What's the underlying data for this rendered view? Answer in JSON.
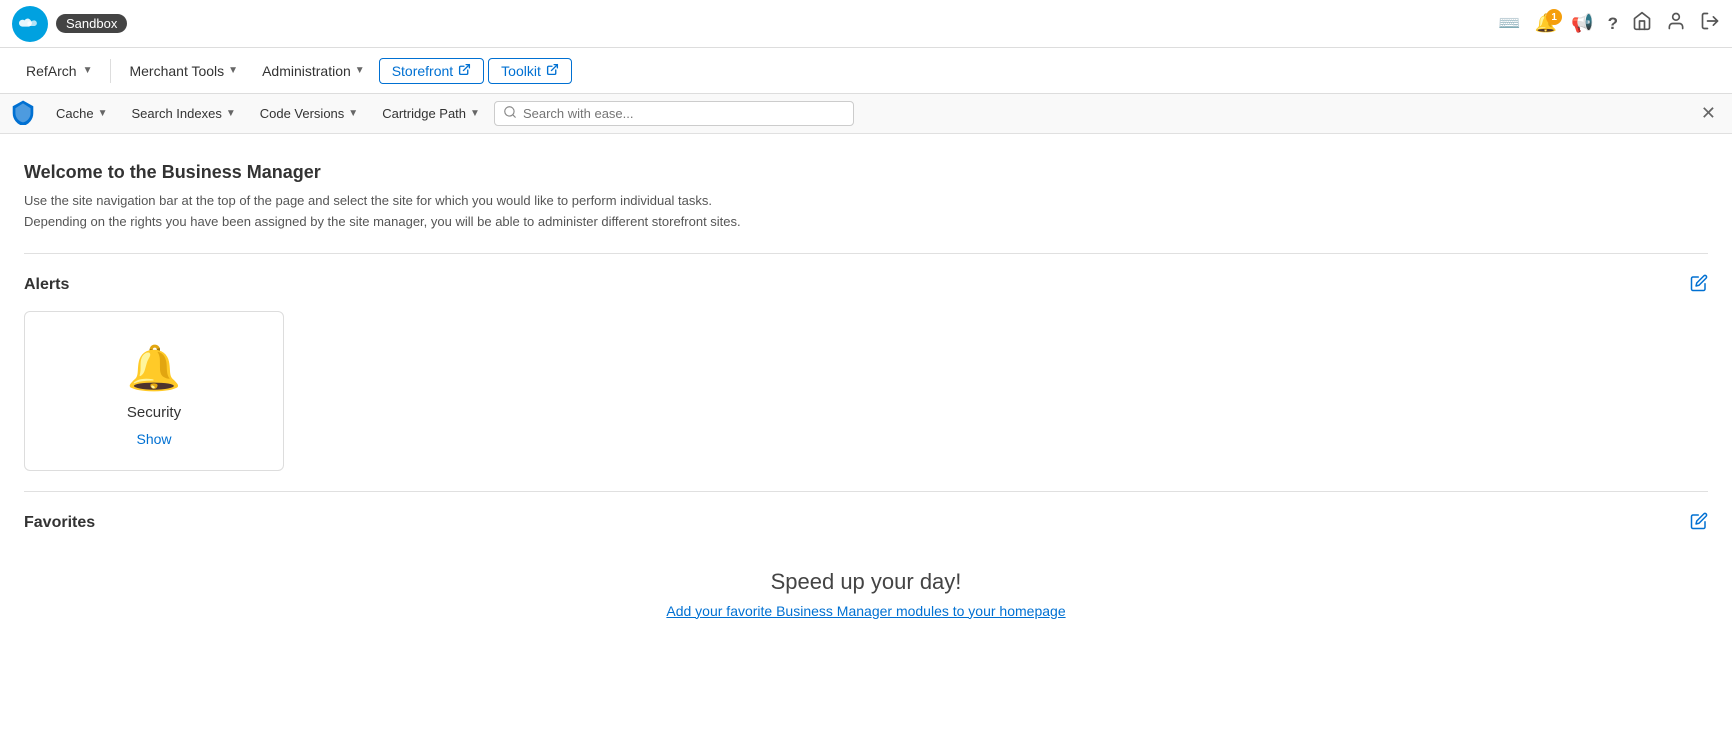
{
  "topBar": {
    "logoAlt": "Salesforce",
    "sandboxLabel": "Sandbox",
    "notificationCount": "1",
    "icons": {
      "keyboard": "⌨",
      "bell": "🔔",
      "megaphone": "📢",
      "help": "?",
      "home": "⌂",
      "user": "👤",
      "signout": "⏻"
    }
  },
  "navBar": {
    "siteSelector": {
      "label": "RefArch",
      "chevron": "▼"
    },
    "items": [
      {
        "label": "Merchant Tools",
        "hasChevron": true
      },
      {
        "label": "Administration",
        "hasChevron": true
      },
      {
        "label": "Storefront",
        "isLink": true,
        "extIcon": "↗"
      },
      {
        "label": "Toolkit",
        "isLink": true,
        "extIcon": "↗"
      }
    ]
  },
  "subNavBar": {
    "items": [
      {
        "label": "Cache",
        "hasChevron": true
      },
      {
        "label": "Search Indexes",
        "hasChevron": true
      },
      {
        "label": "Code Versions",
        "hasChevron": true
      },
      {
        "label": "Cartridge Path",
        "hasChevron": true
      }
    ],
    "searchPlaceholder": "Search with ease..."
  },
  "welcomeSection": {
    "title": "Welcome to the Business Manager",
    "description1": "Use the site navigation bar at the top of the page and select the site for which you would like to perform individual tasks.",
    "description2": "Depending on the rights you have been assigned by the site manager, you will be able to administer different storefront sites."
  },
  "alertsSection": {
    "title": "Alerts",
    "editIconLabel": "✏",
    "cards": [
      {
        "bellIcon": "🔔",
        "title": "Security",
        "linkLabel": "Show"
      }
    ]
  },
  "favoritesSection": {
    "title": "Favorites",
    "editIconLabel": "✏",
    "tagline": "Speed up your day!",
    "sublinkLabel": "Add your favorite Business Manager modules to your homepage"
  }
}
